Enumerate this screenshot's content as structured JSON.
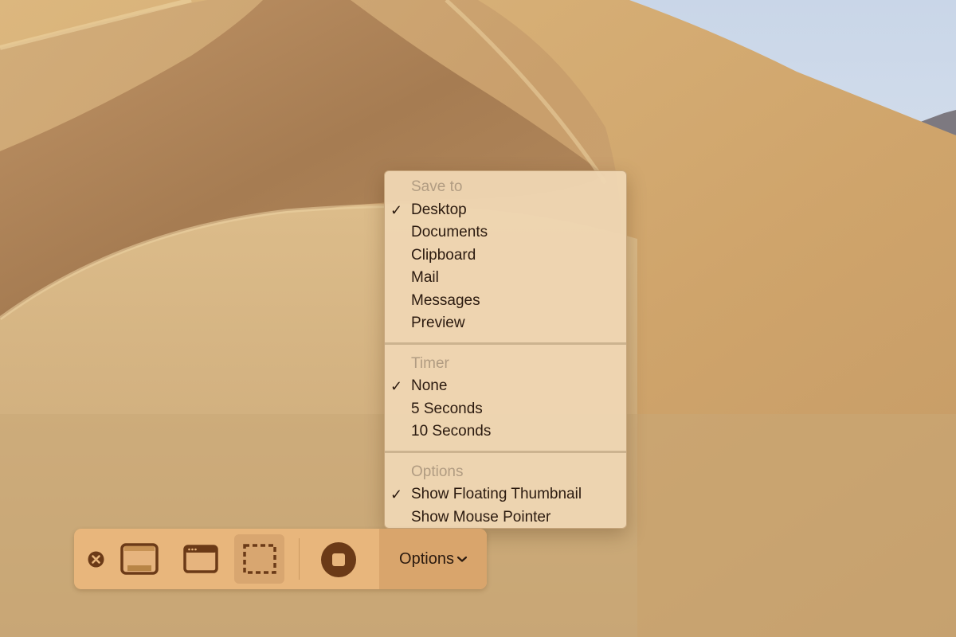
{
  "wallpaper": {
    "name": "desert-dunes",
    "colors": {
      "sky": "#dfe7f2",
      "sand_light": "#e6c48a",
      "sand_mid": "#cfa66d",
      "sand_shadow": "#a77d52",
      "mountain": "#7d7980"
    }
  },
  "menu": {
    "sections": [
      {
        "header": "Save to",
        "items": [
          {
            "label": "Desktop",
            "checked": true
          },
          {
            "label": "Documents",
            "checked": false
          },
          {
            "label": "Clipboard",
            "checked": false
          },
          {
            "label": "Mail",
            "checked": false
          },
          {
            "label": "Messages",
            "checked": false
          },
          {
            "label": "Preview",
            "checked": false
          }
        ]
      },
      {
        "header": "Timer",
        "items": [
          {
            "label": "None",
            "checked": true
          },
          {
            "label": "5 Seconds",
            "checked": false
          },
          {
            "label": "10 Seconds",
            "checked": false
          }
        ]
      },
      {
        "header": "Options",
        "items": [
          {
            "label": "Show Floating Thumbnail",
            "checked": true
          },
          {
            "label": "Show Mouse Pointer",
            "checked": false
          }
        ]
      }
    ],
    "check_glyph": "✓"
  },
  "toolbar": {
    "close_icon": "close-circle-icon",
    "capture_entire_screen_icon": "entire-screen-icon",
    "capture_window_icon": "window-icon",
    "capture_selection_icon": "selection-icon",
    "capture_selection_active": true,
    "record_icon": "record-stop-icon",
    "options_label": "Options",
    "options_chevron": "chevron-down-icon",
    "colors": {
      "bar": "#e8b67c",
      "icon": "#6b3a17",
      "active_bg": "#d8a670"
    }
  }
}
